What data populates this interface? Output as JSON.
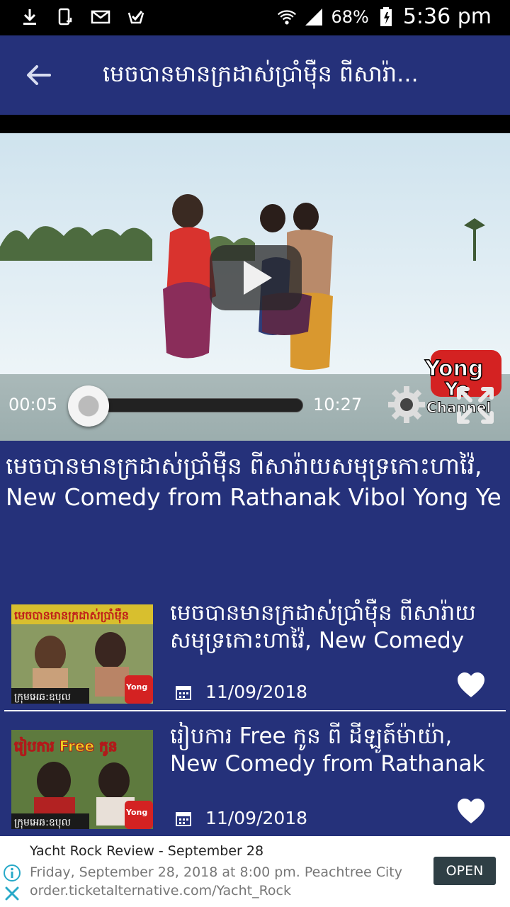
{
  "status_bar": {
    "battery": "68%",
    "time": "5:36 pm",
    "icons": [
      "download-icon",
      "screen-rotate-icon",
      "mail-icon",
      "checkbox-icon",
      "wifi-icon",
      "signal-icon",
      "battery-icon"
    ]
  },
  "app_bar": {
    "title": "មេចបានមានក្រដាស់ប្រាំម៉ឺន ពីសារ៉ា...",
    "back_icon": "arrow-left-icon"
  },
  "player": {
    "current_time": "00:05",
    "total_time": "10:27",
    "progress": 0.008,
    "watermark": "Yong Ye Channel",
    "icons": [
      "play-icon",
      "gear-icon",
      "fullscreen-icon"
    ]
  },
  "video": {
    "title": "មេចបានមានក្រដាស់ប្រាំម៉ឺន ពីសារ៉ាយសមុទ្រកោះហាវ៉ៃ, New Comedy from Rathanak Vibol Yong Ye"
  },
  "related": [
    {
      "title": "មេចបានមានក្រដាស់ប្រាំម៉ឺន ពីសារ៉ាយសមុទ្រកោះហាវ៉ៃ, New Comedy",
      "thumb_text": "មេចបានមានក្រដាស់ប្រាំម៉ឺន",
      "thumb_footer": "ក្រុមអេឆ:ឧបុល",
      "date": "11/09/2018"
    },
    {
      "title": "រៀបការ Free កូន ពី ដីឡូត៍ម៉ាយ៉ា, New Comedy from Rathanak",
      "thumb_text": "រៀបការ Free កូន",
      "thumb_footer": "ក្រុមអេឆ:ឧបុល",
      "date": "11/09/2018"
    }
  ],
  "ad": {
    "title": "Yacht Rock Review - September 28",
    "description": "Friday, September 28, 2018 at 8:00 pm. Peachtree City",
    "url": "order.ticketalternative.com/Yacht_Rock",
    "cta": "OPEN"
  },
  "colors": {
    "primary": "#25317a",
    "background": "#25317a",
    "text": "#ffffff"
  }
}
